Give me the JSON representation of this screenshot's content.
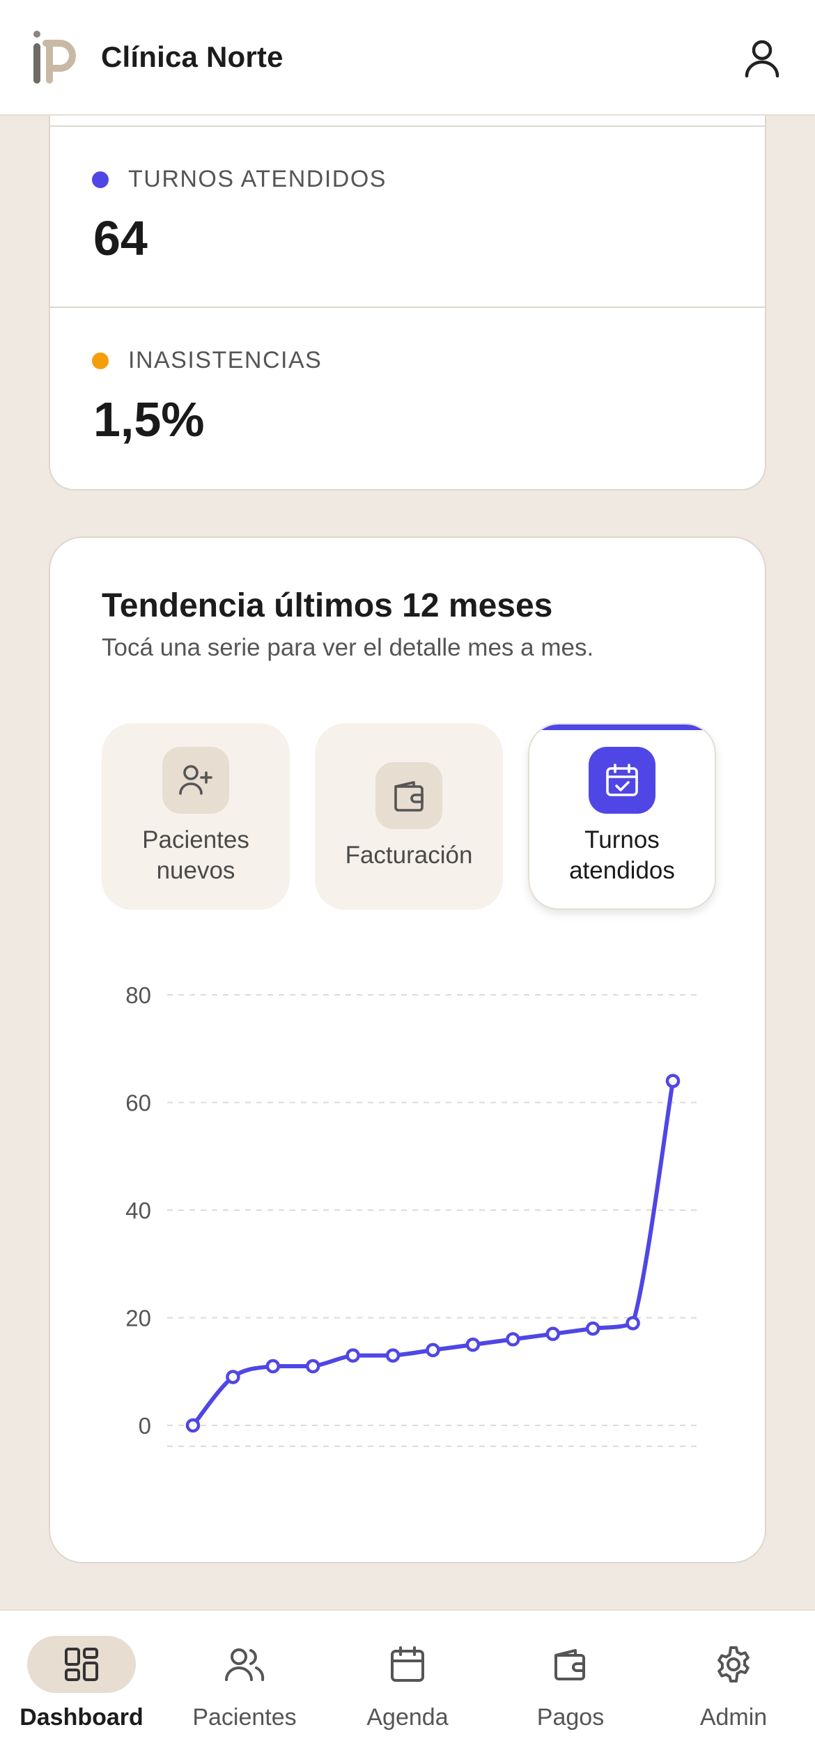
{
  "header": {
    "clinic_name": "Clínica Norte"
  },
  "stats": [
    {
      "label": "TURNOS ATENDIDOS",
      "value": "64",
      "dot_color": "#4f46e5"
    },
    {
      "label": "INASISTENCIAS",
      "value": "1,5%",
      "dot_color": "#f59e0b"
    }
  ],
  "trend": {
    "title": "Tendencia últimos 12 meses",
    "subtitle": "Tocá una serie para ver el detalle mes a mes.",
    "tabs": [
      {
        "label_line1": "Pacientes",
        "label_line2": "nuevos",
        "icon": "user-plus-icon",
        "active": false
      },
      {
        "label_line1": "Facturación",
        "label_line2": "",
        "icon": "wallet-icon",
        "active": false
      },
      {
        "label_line1": "Turnos",
        "label_line2": "atendidos",
        "icon": "calendar-check-icon",
        "active": true
      }
    ]
  },
  "chart_data": {
    "type": "line",
    "series": [
      {
        "values": [
          0,
          9,
          11,
          11,
          13,
          13,
          14,
          15,
          16,
          17,
          18,
          19,
          64
        ]
      }
    ],
    "yticks": [
      "0",
      "20",
      "40",
      "60",
      "80"
    ],
    "ylim": [
      0,
      80
    ],
    "grid": true,
    "color": "#4f46e5"
  },
  "nav": {
    "items": [
      {
        "label": "Dashboard",
        "icon": "dashboard-icon",
        "active": true
      },
      {
        "label": "Pacientes",
        "icon": "users-icon",
        "active": false
      },
      {
        "label": "Agenda",
        "icon": "calendar-icon",
        "active": false
      },
      {
        "label": "Pagos",
        "icon": "wallet-icon",
        "active": false
      },
      {
        "label": "Admin",
        "icon": "gear-icon",
        "active": false
      }
    ]
  },
  "colors": {
    "accent": "#4f46e5",
    "warning": "#f59e0b",
    "background": "#efe9e1"
  }
}
